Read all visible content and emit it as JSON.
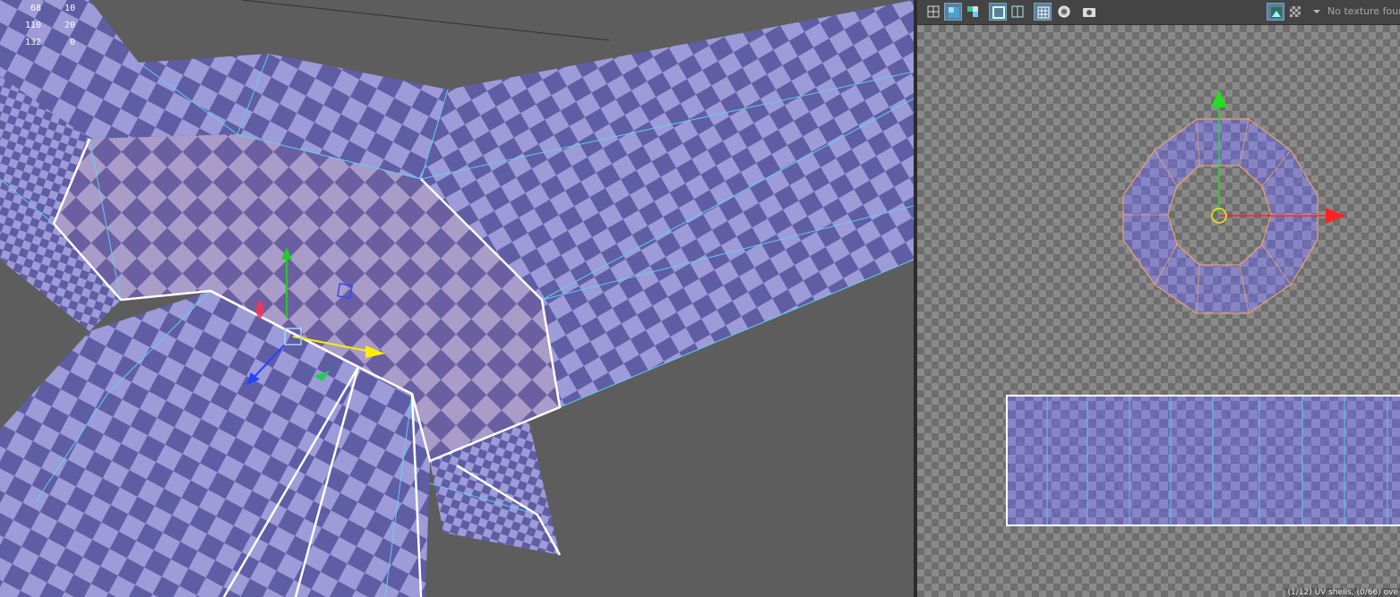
{
  "hud": {
    "rows": [
      {
        "a": "68",
        "b": "10"
      },
      {
        "a": "110",
        "b": "20"
      },
      {
        "a": "132",
        "b": "0"
      }
    ]
  },
  "uv_editor": {
    "texture_status": "No texture found",
    "shell_status": "(1/12) UV shells, (0/66) ove",
    "toolbar_icons": [
      "grid-icon",
      "uv-shading-icon",
      "distortion-icon",
      "texture-border-icon",
      "shell-border-icon",
      "grid-snap-icon",
      "image-dim-icon",
      "snapshot-icon",
      "image-display-icon",
      "checker-icon",
      "dropdown-arrow-icon"
    ]
  },
  "colors": {
    "checker_light": "#9b9ad6",
    "checker_dark": "#5e5ca3",
    "selection_white": "#ffffff",
    "edge_cyan": "#5fd1f5",
    "shell_border_orange": "#f0a36a",
    "gizmo_x_red": "#ff1f1f",
    "gizmo_y_green": "#22cc22",
    "gizmo_z_blue": "#2244ff",
    "viewport_bg": "#5d5d5d"
  }
}
